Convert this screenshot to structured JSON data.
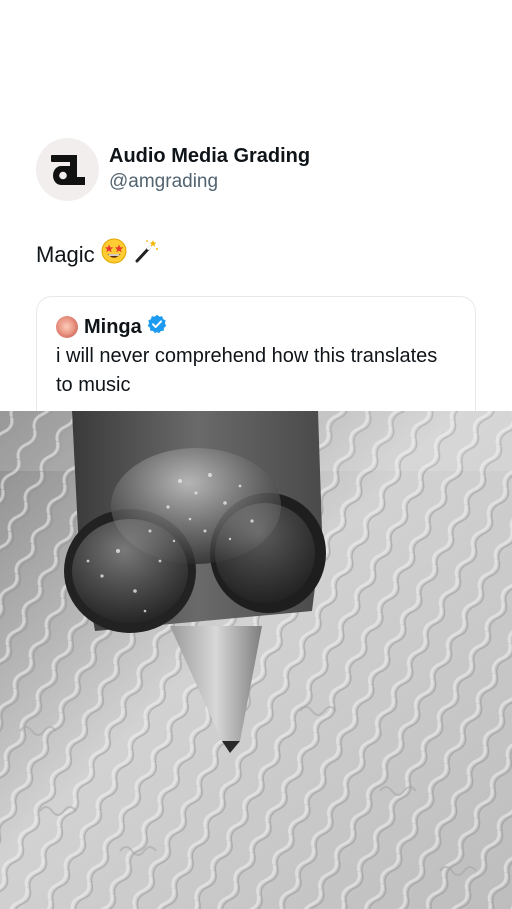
{
  "author": {
    "name": "Audio Media Grading",
    "handle": "@amgrading",
    "avatar_icon": "audio-media-grading-logo-icon"
  },
  "tweet": {
    "text": "Magic",
    "emojis": [
      "star-struck-emoji-icon",
      "magic-wand-emoji-icon"
    ]
  },
  "quote": {
    "name": "Minga",
    "verified": true,
    "verified_color": "#1d9bf0",
    "text": "i will never comprehend how this translates to music"
  },
  "media": {
    "description_icon": "record-needle-microscope-image"
  },
  "colors": {
    "text": "#0f1419",
    "secondary": "#536471",
    "border": "#e6e9ec"
  }
}
